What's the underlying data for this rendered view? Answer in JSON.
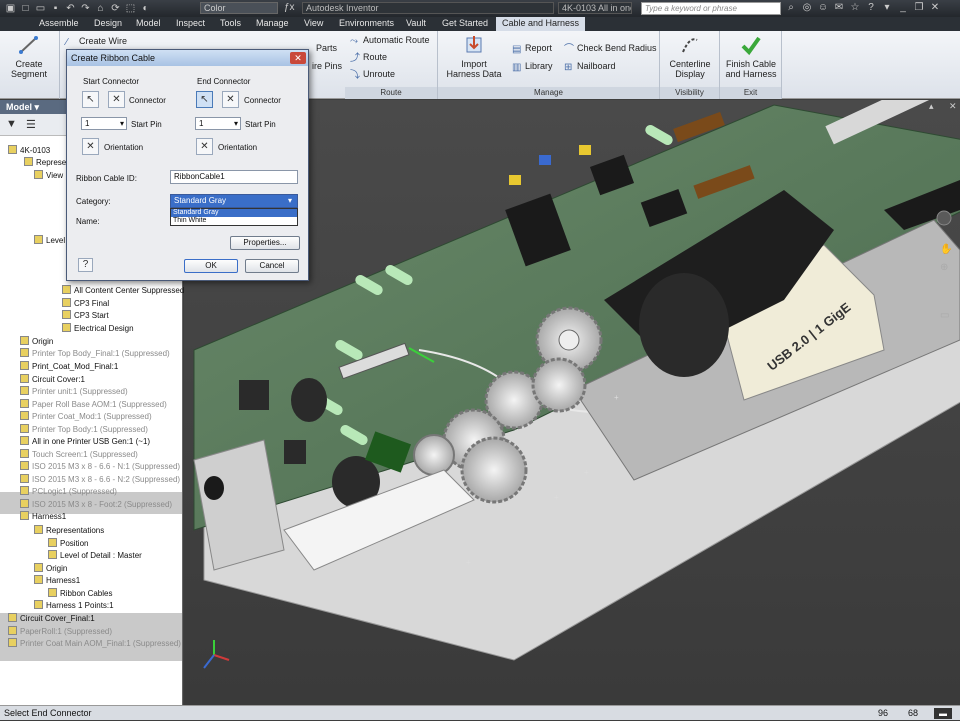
{
  "titlebar": {
    "appearance_combo": "Color",
    "app_title": "Autodesk Inventor",
    "doc_title": "4K-0103 All in one",
    "search_placeholder": "Type a keyword or phrase"
  },
  "tabs": [
    "Assemble",
    "Design",
    "Model",
    "Inspect",
    "Tools",
    "Manage",
    "View",
    "Environments",
    "Vault",
    "Get Started",
    "Cable and Harness"
  ],
  "active_tab": "Cable and Harness",
  "ribbon": {
    "create_segment": "Create Segment",
    "create_wire": "Create Wire",
    "parts": "Parts",
    "wire_pins": "ire Pins",
    "automatic_route": "Automatic Route",
    "route": "Route",
    "unroute": "Unroute",
    "route_panel": "Route",
    "import_harness": "Import Harness Data",
    "report": "Report",
    "library": "Library",
    "check_bend": "Check Bend Radius",
    "nailboard": "Nailboard",
    "manage_panel": "Manage",
    "centerline": "Centerline Display",
    "visibility_panel": "Visibility",
    "finish_cable": "Finish Cable and Harness",
    "exit_panel": "Exit"
  },
  "dialog": {
    "title": "Create Ribbon Cable",
    "start_connector": "Start Connector",
    "end_connector": "End Connector",
    "connector": "Connector",
    "start_pin_value": "1",
    "start_pin": "Start Pin",
    "orientation": "Orientation",
    "ribbon_cable_id_label": "Ribbon Cable ID:",
    "ribbon_cable_id": "RibbonCable1",
    "category_label": "Category:",
    "category_value": "Standard Gray",
    "category_options": [
      "Standard Gray",
      "Thin White"
    ],
    "name_label": "Name:",
    "properties": "Properties...",
    "ok": "OK",
    "cancel": "Cancel"
  },
  "browser": {
    "header": "Model",
    "items": [
      {
        "label": "4K-0103",
        "dim": false
      },
      {
        "label": "Represe",
        "dim": false
      },
      {
        "label": "View",
        "dim": false
      },
      {
        "label": "Level",
        "dim": false
      },
      {
        "label": "All Content Center Suppressed",
        "dim": false
      },
      {
        "label": "CP3 Final",
        "dim": false
      },
      {
        "label": "CP3 Start",
        "dim": false
      },
      {
        "label": "Electrical Design",
        "dim": false
      },
      {
        "label": "Origin",
        "dim": false
      },
      {
        "label": "Printer Top Body_Final:1 (Suppressed)",
        "dim": true
      },
      {
        "label": "Print_Coat_Mod_Final:1",
        "dim": false
      },
      {
        "label": "Circuit Cover:1",
        "dim": false
      },
      {
        "label": "Printer unit:1 (Suppressed)",
        "dim": true
      },
      {
        "label": "Paper Roll Base AOM:1 (Suppressed)",
        "dim": true
      },
      {
        "label": "Printer Coat_Mod:1 (Suppressed)",
        "dim": true
      },
      {
        "label": "Printer Top Body:1 (Suppressed)",
        "dim": true
      },
      {
        "label": "All in one Printer USB Gen:1 (~1)",
        "dim": false
      },
      {
        "label": "Touch Screen:1 (Suppressed)",
        "dim": true
      },
      {
        "label": "ISO 2015 M3 x 8 - 6.6 - N:1 (Suppressed)",
        "dim": true
      },
      {
        "label": "ISO 2015 M3 x 8 - 6.6 - N:2 (Suppressed)",
        "dim": true
      },
      {
        "label": "PCLogic1 (Suppressed)",
        "dim": true
      },
      {
        "label": "ISO 2015 M3 x 8 - Foot:2 (Suppressed)",
        "dim": true
      },
      {
        "label": "Harness1",
        "dim": false
      },
      {
        "label": "Representations",
        "dim": false
      },
      {
        "label": "Position",
        "dim": false
      },
      {
        "label": "Level of Detail : Master",
        "dim": false
      },
      {
        "label": "Origin",
        "dim": false
      },
      {
        "label": "Harness1",
        "dim": false
      },
      {
        "label": "Ribbon Cables",
        "dim": false
      },
      {
        "label": "Harness 1 Points:1",
        "dim": false
      },
      {
        "label": "Circuit Cover_Final:1",
        "dim": false
      },
      {
        "label": "PaperRoll:1 (Suppressed)",
        "dim": true
      },
      {
        "label": "Printer Coat Main AOM_Final:1 (Suppressed)",
        "dim": true
      }
    ]
  },
  "viewport": {
    "usb_label": "USB 2.0 | 1 GigE"
  },
  "status": {
    "message": "Select End Connector",
    "num1": "96",
    "num2": "68"
  }
}
